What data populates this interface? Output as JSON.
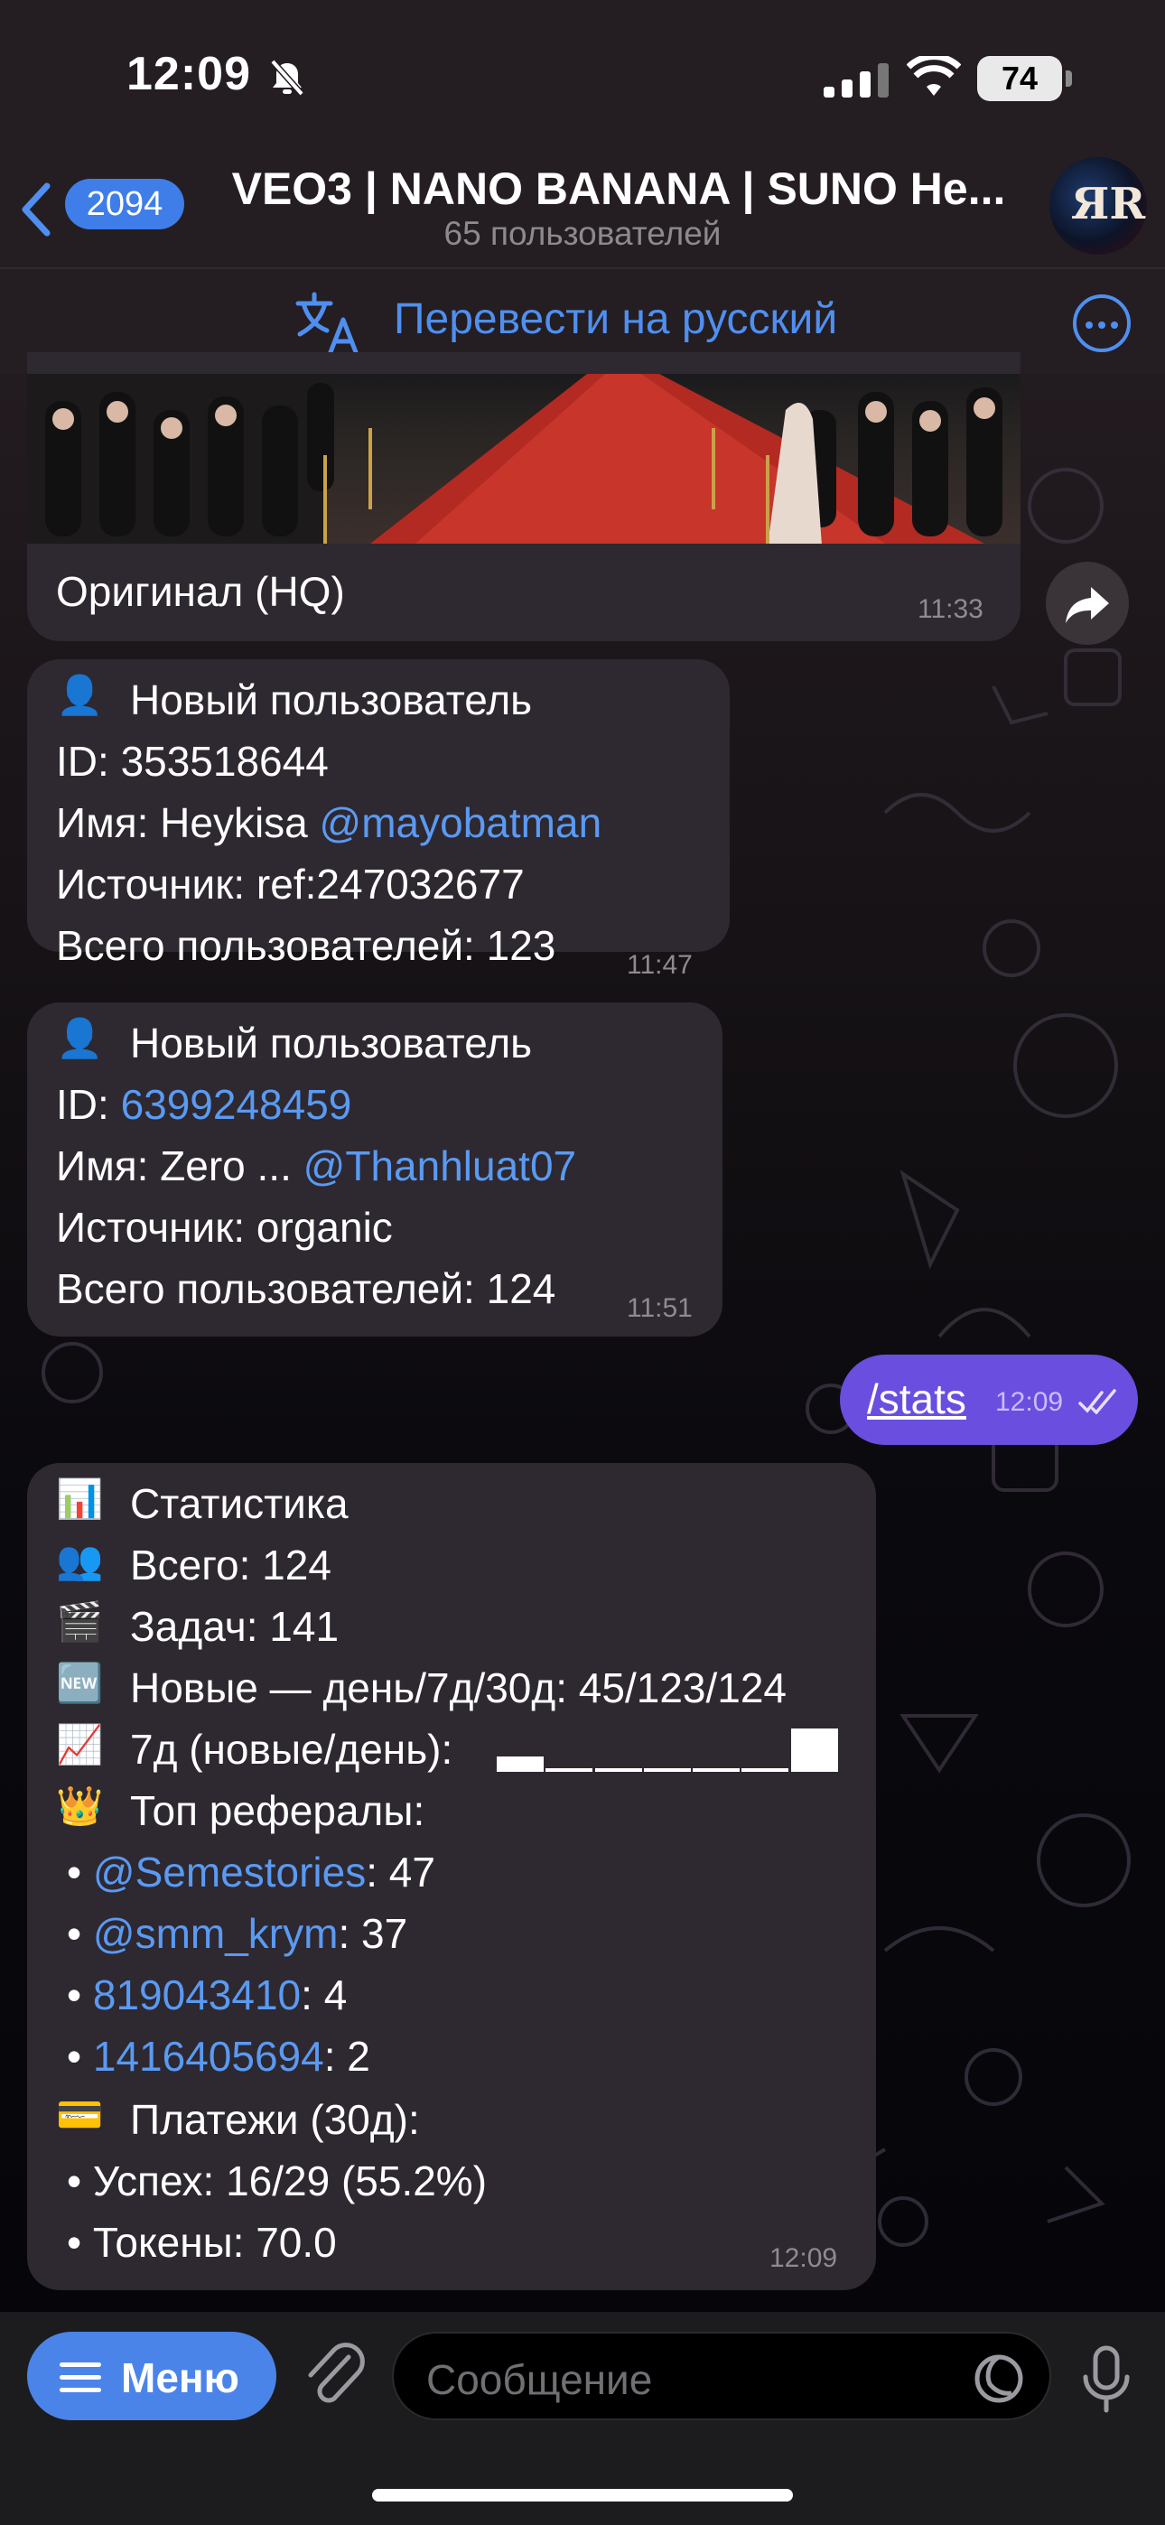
{
  "status_bar": {
    "time": "12:09",
    "battery": "74"
  },
  "header": {
    "back_count": "2094",
    "title": "VEO3 | NANO BANANA | SUNO Не...",
    "subtitle": "65 пользователей",
    "avatar_letters": "ЯR"
  },
  "translate_bar": {
    "label": "Перевести на русский"
  },
  "messages": [
    {
      "caption": "Оригинал (HQ)",
      "time": "11:33"
    },
    {
      "icon": "👤",
      "title": "Новый пользователь",
      "id_label": "ID: ",
      "id_value": "353518644",
      "name_label": "Имя: Heykisa ",
      "name_link": "@mayobatman",
      "source": "Источник: ref:247032677",
      "total": "Всего пользователей: 123",
      "time": "11:47"
    },
    {
      "icon": "👤",
      "title": "Новый пользователь",
      "id_label": "ID: ",
      "id_value": "6399248459",
      "name_label": "Имя: Zero ... ",
      "name_link": "@Thanhluat07",
      "source": "Источник: organic",
      "total": "Всего пользователей: 124",
      "time": "11:51"
    },
    {
      "text": "/stats",
      "time": "12:09",
      "status": "read"
    },
    {
      "lines": [
        {
          "icon": "📊",
          "text": "Статистика"
        },
        {
          "icon": "👥",
          "text": "Всего: 124"
        },
        {
          "icon": "🎬",
          "text": "Задач: 141"
        },
        {
          "icon": "🆕",
          "text": "Новые — день/7д/30д: 45/123/124"
        },
        {
          "icon": "📈",
          "text": "7д (новые/день): "
        },
        {
          "icon": "👑",
          "text": "Топ рефералы:"
        }
      ],
      "sparkline_levels": [
        0.35,
        0.05,
        0.05,
        0.05,
        0.05,
        0.05,
        1.0
      ],
      "referrals": [
        {
          "name": "@Semestories",
          "count": ": 47"
        },
        {
          "name": "@smm_krym",
          "count": ": 37"
        },
        {
          "name": "819043410",
          "count": ": 4"
        },
        {
          "name": "1416405694",
          "count": ": 2"
        }
      ],
      "payments_icon": "💳",
      "payments_title": "Платежи (30д):",
      "success": "• Успех: 16/29 (55.2%)",
      "tokens": "• Токены: 70.0",
      "bullet": "•",
      "time": "12:09"
    }
  ],
  "composer": {
    "menu_label": "Меню",
    "placeholder": "Сообщение"
  },
  "colors": {
    "accent": "#4f8ff0",
    "link": "#5a9af2",
    "outgoing": "#6a4ee0",
    "incoming": "#2e2830"
  }
}
